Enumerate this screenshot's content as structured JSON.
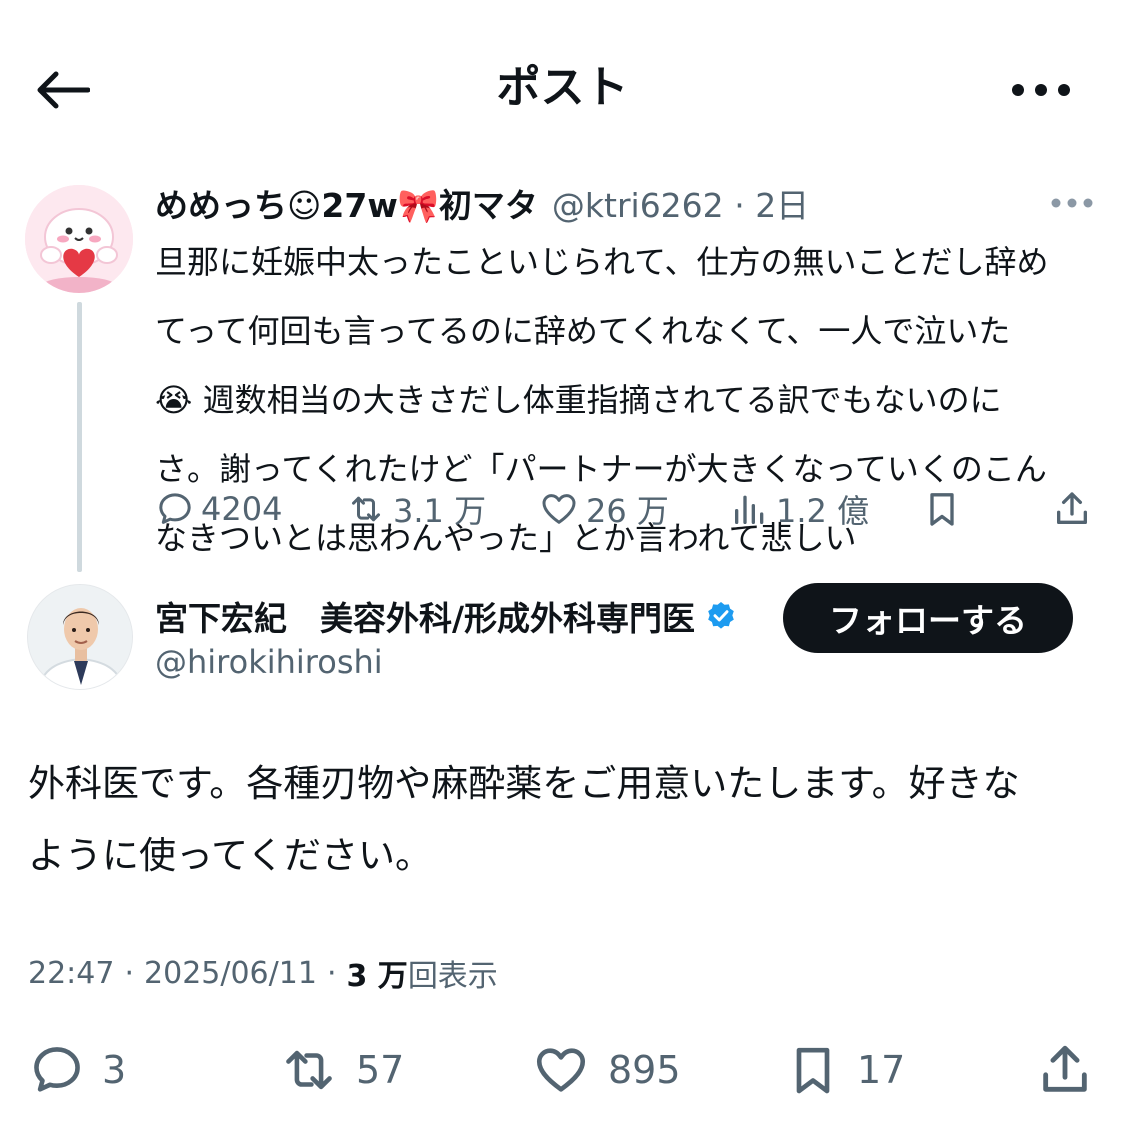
{
  "header": {
    "title": "ポスト"
  },
  "parent_post": {
    "display_name": "めめっち☺27w🎀初マタ",
    "handle": "@ktri6262",
    "separator": "·",
    "time_ago": "2日",
    "text": "旦那に妊娠中太ったこといじられて、仕方の無いことだし辞め\nてって何回も言ってるのに辞めてくれなくて、一人で泣いた\n😭 週数相当の大きさだし体重指摘されてる訳でもないのに\nさ。謝ってくれたけど「パートナーが大きくなっていくのこん\nなきついとは思わんやった」とか言われて悲しい",
    "replies": "4204",
    "reposts": "3.1 万",
    "likes": "26 万",
    "views": "1.2 億"
  },
  "main_post": {
    "display_name": "宮下宏紀　美容外科/形成外科専門医",
    "handle": "@hirokihiroshi",
    "follow_label": "フォローする",
    "text": "外科医です。各種刃物や麻酔薬をご用意いたします。好きな\nように使ってください。",
    "time": "22:47",
    "date": "2025/06/11",
    "separator": "·",
    "view_count": "3 万",
    "view_label": "回表示",
    "replies": "3",
    "reposts": "57",
    "likes": "895",
    "bookmarks": "17"
  },
  "colors": {
    "text": "#0f1419",
    "secondary": "#536471",
    "verified": "#1d9bf0",
    "line": "#cfd9de"
  }
}
